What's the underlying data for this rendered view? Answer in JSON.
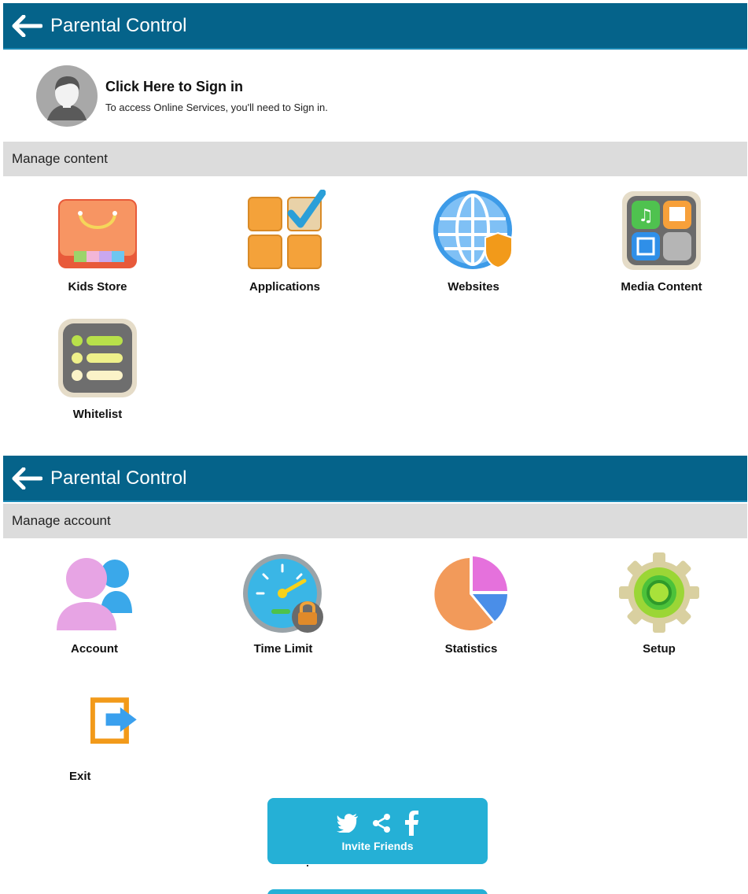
{
  "screen1": {
    "appbar": {
      "title": "Parental Control"
    },
    "signin": {
      "title": "Click Here to Sign in",
      "subtitle": "To access Online Services, you'll need to Sign in."
    },
    "section_label": "Manage content",
    "tiles": [
      {
        "label": "Kids Store",
        "icon": "shopping-bag-icon"
      },
      {
        "label": "Applications",
        "icon": "apps-grid-icon"
      },
      {
        "label": "Websites",
        "icon": "globe-shield-icon"
      },
      {
        "label": "Media Content",
        "icon": "media-folder-icon"
      },
      {
        "label": "Whitelist",
        "icon": "checklist-icon"
      }
    ]
  },
  "screen2": {
    "appbar": {
      "title": "Parental Control"
    },
    "section_label": "Manage account",
    "tiles": [
      {
        "label": "Account",
        "icon": "user-accounts-icon"
      },
      {
        "label": "Time Limit",
        "icon": "speedometer-lock-icon"
      },
      {
        "label": "Statistics",
        "icon": "pie-chart-icon"
      },
      {
        "label": "Setup",
        "icon": "gear-icon"
      },
      {
        "label": "Exit",
        "icon": "exit-door-icon"
      }
    ],
    "invite": {
      "label": "Invite Friends",
      "icons": [
        "twitter-icon",
        "share-icon",
        "facebook-icon"
      ]
    }
  },
  "colors": {
    "appbar": "#05638a",
    "section_bg": "#dcdcdc",
    "invite_button": "#25b0d6"
  }
}
